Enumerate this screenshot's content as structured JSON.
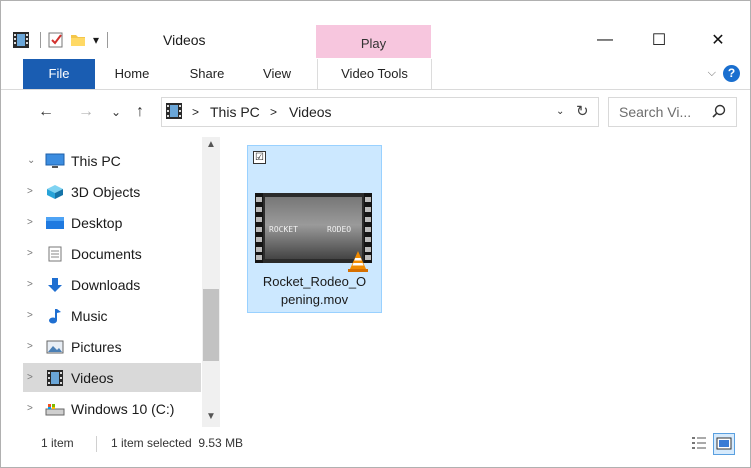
{
  "window": {
    "title": "Videos",
    "play_context_label": "Play",
    "controls": {
      "minimize": "—",
      "maximize": "☐",
      "close": "✕"
    }
  },
  "ribbon": {
    "tabs": [
      "File",
      "Home",
      "Share",
      "View",
      "Video Tools"
    ],
    "collapse_chevron": "⌵",
    "help": "?"
  },
  "address": {
    "back": "←",
    "forward": "→",
    "recent": "⌄",
    "up": "↑",
    "crumbs": [
      "This PC",
      "Videos"
    ],
    "crumb_sep": ">",
    "refresh": "↻",
    "search_placeholder": "Search Vi..."
  },
  "nav": {
    "items": [
      {
        "label": "This PC",
        "icon": "monitor-icon",
        "expander": "⌄",
        "selected": false
      },
      {
        "label": "3D Objects",
        "icon": "cube-icon",
        "expander": ">",
        "selected": false
      },
      {
        "label": "Desktop",
        "icon": "desktop-icon",
        "expander": ">",
        "selected": false
      },
      {
        "label": "Documents",
        "icon": "document-icon",
        "expander": ">",
        "selected": false
      },
      {
        "label": "Downloads",
        "icon": "download-arrow-icon",
        "expander": ">",
        "selected": false
      },
      {
        "label": "Music",
        "icon": "music-note-icon",
        "expander": ">",
        "selected": false
      },
      {
        "label": "Pictures",
        "icon": "picture-icon",
        "expander": ">",
        "selected": false
      },
      {
        "label": "Videos",
        "icon": "film-icon",
        "expander": ">",
        "selected": true
      },
      {
        "label": "Windows 10 (C:)",
        "icon": "drive-icon",
        "expander": ">",
        "selected": false
      }
    ]
  },
  "files": [
    {
      "name_line1": "Rocket_Rodeo_O",
      "name_line2": "pening.mov",
      "thumb_text_left": "ROCKET",
      "thumb_text_right": "RODEO",
      "checked": "☑",
      "selected": true
    }
  ],
  "status": {
    "count": "1 item",
    "selection": "1 item selected  9.53 MB"
  },
  "colors": {
    "file_tab": "#1a5db2",
    "play_context": "#f7c6de",
    "selection_fill": "#cce8ff",
    "selection_border": "#99d1ff",
    "nav_selected": "#d9d9d9"
  }
}
